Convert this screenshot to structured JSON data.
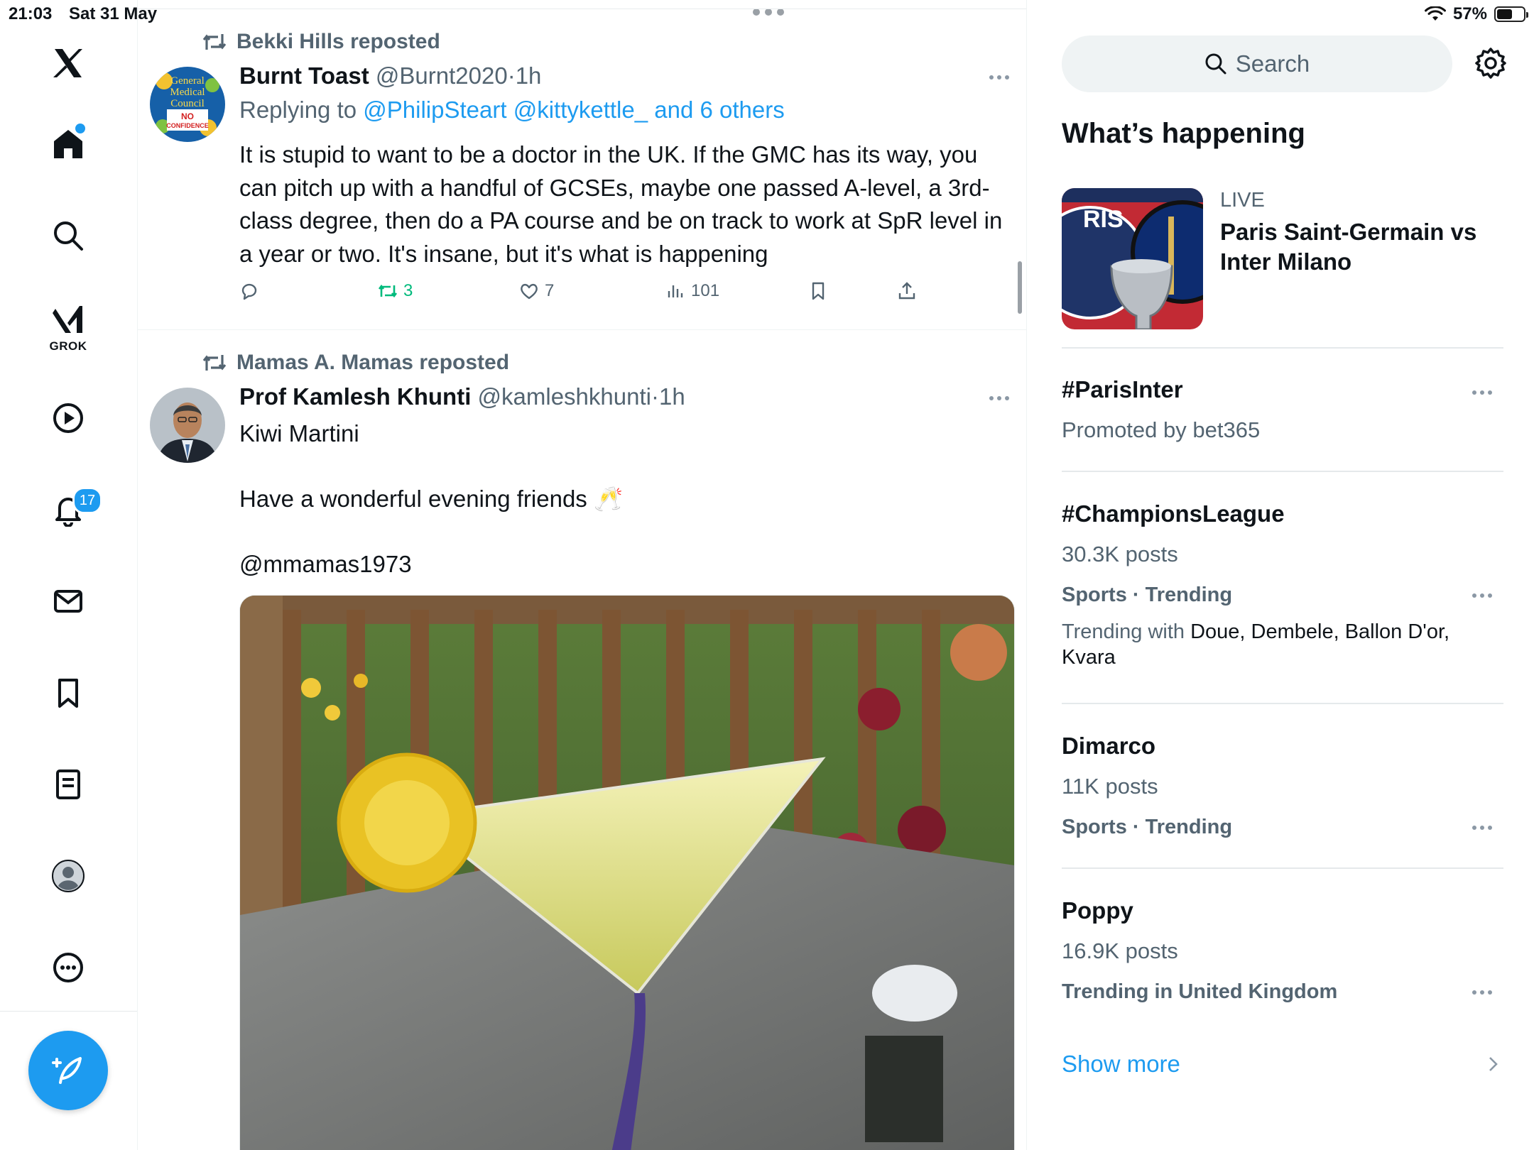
{
  "status_bar": {
    "time": "21:03",
    "date": "Sat 31 May",
    "battery": "57%",
    "battery_level": 0.57
  },
  "nav": {
    "grok_label": "GROK",
    "notifications_badge": "17",
    "items": [
      "x-logo",
      "home",
      "search",
      "grok",
      "video",
      "notifications",
      "messages",
      "bookmarks",
      "lists",
      "profile",
      "more"
    ]
  },
  "tweets": [
    {
      "reposted_by": "Bekki Hills reposted",
      "name": "Burnt Toast",
      "handle": "@Burnt2020",
      "sep": "·",
      "time": "1h",
      "replying_prefix": "Replying to",
      "replying_links": "@PhilipSteart @kittykettle_ and 6 others",
      "body": "It is stupid to want to be a doctor in the UK. If the GMC has its way, you can pitch up with a handful of GCSEs, maybe one passed A-level, a 3rd-class degree, then do a PA course and be on track to work at SpR level in a year or two. It's insane, but it's what is happening",
      "avatar_text": [
        "General",
        "Medical",
        "Council",
        "NO",
        "CONFIDENCE"
      ],
      "stats": {
        "retweets": "3",
        "likes": "7",
        "views": "101"
      }
    },
    {
      "reposted_by": "Mamas A. Mamas reposted",
      "name": "Prof Kamlesh Khunti",
      "handle": "@kamleshkhunti",
      "sep": "·",
      "time": "1h",
      "body_line1": "Kiwi Martini",
      "body_line2": "Have a wonderful evening friends 🥂",
      "mention": "@mmamas1973"
    }
  ],
  "sidebar": {
    "search_placeholder": "Search",
    "heading": "What’s happening",
    "live": {
      "label": "LIVE",
      "title": "Paris Saint-Germain vs Inter Milano",
      "image_text": "RIS"
    },
    "trends": [
      {
        "title": "#ParisInter",
        "sub": "Promoted by bet365"
      },
      {
        "title": "#ChampionsLeague",
        "sub": "30.3K posts",
        "category": "Sports · Trending",
        "with_prefix": "Trending with",
        "with_names": "Doue, Dembele, Ballon D'or, Kvara"
      },
      {
        "title": "Dimarco",
        "sub": "11K posts",
        "category": "Sports · Trending"
      },
      {
        "title": "Poppy",
        "sub": "16.9K posts",
        "category": "Trending in United Kingdom"
      }
    ],
    "show_more": "Show more"
  }
}
